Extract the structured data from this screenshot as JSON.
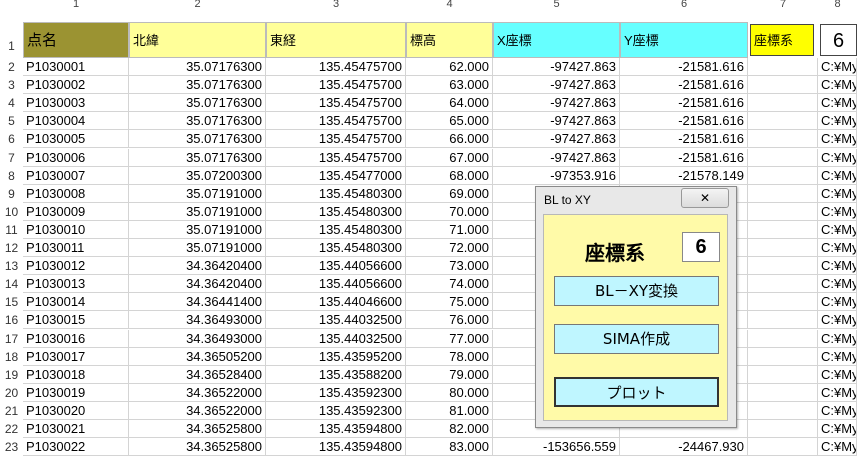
{
  "columns": [
    "1",
    "2",
    "3",
    "4",
    "5",
    "6",
    "7",
    "8"
  ],
  "header": {
    "name": "点名",
    "lat": "北緯",
    "lon": "東経",
    "height": "標高",
    "x": "X座標",
    "y": "Y座標",
    "coord_sys_label": "座標系",
    "coord_sys_value": "6"
  },
  "rows": [
    {
      "n": "2",
      "name": "P1030001",
      "lat": "35.07176300",
      "lon": "135.45475700",
      "h": "62.000",
      "x": "-97427.863",
      "y": "-21581.616",
      "path": "C:¥My"
    },
    {
      "n": "3",
      "name": "P1030002",
      "lat": "35.07176300",
      "lon": "135.45475700",
      "h": "63.000",
      "x": "-97427.863",
      "y": "-21581.616",
      "path": "C:¥My"
    },
    {
      "n": "4",
      "name": "P1030003",
      "lat": "35.07176300",
      "lon": "135.45475700",
      "h": "64.000",
      "x": "-97427.863",
      "y": "-21581.616",
      "path": "C:¥My"
    },
    {
      "n": "5",
      "name": "P1030004",
      "lat": "35.07176300",
      "lon": "135.45475700",
      "h": "65.000",
      "x": "-97427.863",
      "y": "-21581.616",
      "path": "C:¥My"
    },
    {
      "n": "6",
      "name": "P1030005",
      "lat": "35.07176300",
      "lon": "135.45475700",
      "h": "66.000",
      "x": "-97427.863",
      "y": "-21581.616",
      "path": "C:¥My"
    },
    {
      "n": "7",
      "name": "P1030006",
      "lat": "35.07176300",
      "lon": "135.45475700",
      "h": "67.000",
      "x": "-97427.863",
      "y": "-21581.616",
      "path": "C:¥My"
    },
    {
      "n": "8",
      "name": "P1030007",
      "lat": "35.07200300",
      "lon": "135.45477000",
      "h": "68.000",
      "x": "-97353.916",
      "y": "-21578.149",
      "path": "C:¥My"
    },
    {
      "n": "9",
      "name": "P1030008",
      "lat": "35.07191000",
      "lon": "135.45480300",
      "h": "69.000",
      "x": "",
      "y": "",
      "path": "C:¥My"
    },
    {
      "n": "10",
      "name": "P1030009",
      "lat": "35.07191000",
      "lon": "135.45480300",
      "h": "70.000",
      "x": "",
      "y": "",
      "path": "C:¥My"
    },
    {
      "n": "11",
      "name": "P1030010",
      "lat": "35.07191000",
      "lon": "135.45480300",
      "h": "71.000",
      "x": "",
      "y": "",
      "path": "C:¥My"
    },
    {
      "n": "12",
      "name": "P1030011",
      "lat": "35.07191000",
      "lon": "135.45480300",
      "h": "72.000",
      "x": "",
      "y": "",
      "path": "C:¥My"
    },
    {
      "n": "13",
      "name": "P1030012",
      "lat": "34.36420400",
      "lon": "135.44056600",
      "h": "73.000",
      "x": "",
      "y": "",
      "path": "C:¥My"
    },
    {
      "n": "14",
      "name": "P1030013",
      "lat": "34.36420400",
      "lon": "135.44056600",
      "h": "74.000",
      "x": "",
      "y": "",
      "path": "C:¥My"
    },
    {
      "n": "15",
      "name": "P1030014",
      "lat": "34.36441400",
      "lon": "135.44046600",
      "h": "75.000",
      "x": "",
      "y": "",
      "path": "C:¥My"
    },
    {
      "n": "16",
      "name": "P1030015",
      "lat": "34.36493000",
      "lon": "135.44032500",
      "h": "76.000",
      "x": "",
      "y": "",
      "path": "C:¥My"
    },
    {
      "n": "17",
      "name": "P1030016",
      "lat": "34.36493000",
      "lon": "135.44032500",
      "h": "77.000",
      "x": "",
      "y": "",
      "path": "C:¥My"
    },
    {
      "n": "18",
      "name": "P1030017",
      "lat": "34.36505200",
      "lon": "135.43595200",
      "h": "78.000",
      "x": "",
      "y": "",
      "path": "C:¥My"
    },
    {
      "n": "19",
      "name": "P1030018",
      "lat": "34.36528400",
      "lon": "135.43588200",
      "h": "79.000",
      "x": "",
      "y": "",
      "path": "C:¥My"
    },
    {
      "n": "20",
      "name": "P1030019",
      "lat": "34.36522000",
      "lon": "135.43592300",
      "h": "80.000",
      "x": "",
      "y": "",
      "path": "C:¥My"
    },
    {
      "n": "21",
      "name": "P1030020",
      "lat": "34.36522000",
      "lon": "135.43592300",
      "h": "81.000",
      "x": "",
      "y": "",
      "path": "C:¥My"
    },
    {
      "n": "22",
      "name": "P1030021",
      "lat": "34.36525800",
      "lon": "135.43594800",
      "h": "82.000",
      "x": "",
      "y": "",
      "path": "C:¥My"
    },
    {
      "n": "23",
      "name": "P1030022",
      "lat": "34.36525800",
      "lon": "135.43594800",
      "h": "83.000",
      "x": "-153656.559",
      "y": "-24467.930",
      "path": "C:¥My"
    }
  ],
  "dialog": {
    "title": "BL to XY",
    "label": "座標系",
    "value": "6",
    "btn_convert": "BL－XY変換",
    "btn_sima": "SIMA作成",
    "btn_plot": "プロット"
  },
  "colors": {
    "name_header": "#9b9332",
    "yellow_header": "#ffff99",
    "cyan_header": "#66ffff",
    "coord_header": "#ffff00"
  }
}
